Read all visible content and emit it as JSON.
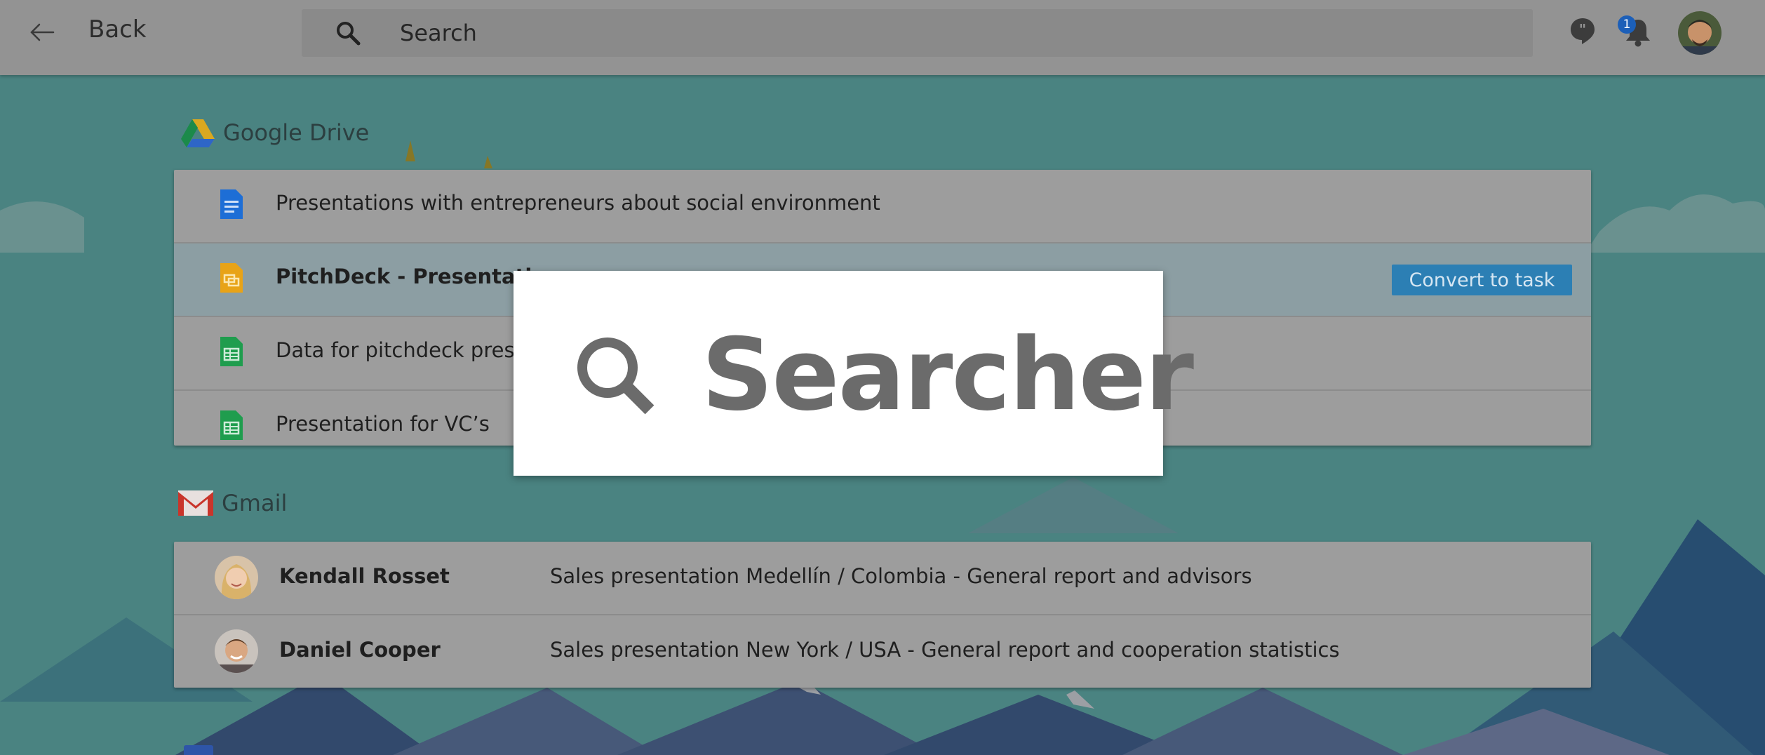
{
  "topbar": {
    "back_label": "Back",
    "search_placeholder": "Search",
    "notification_count": "1",
    "icons": [
      "arrow-left-icon",
      "search-icon",
      "chat-icon",
      "bell-icon",
      "avatar"
    ]
  },
  "drive": {
    "label": "Google Drive",
    "files": [
      {
        "title": "Presentations with entrepreneurs about social environment",
        "icon": "doc-icon",
        "color": "#1d6ed6"
      },
      {
        "title": "PitchDeck - Presentation",
        "icon": "slides-icon",
        "color": "#e8a317",
        "highlighted": true
      },
      {
        "title": "Data for pitchdeck presen",
        "icon": "sheet-icon",
        "color": "#1f9d4e"
      },
      {
        "title": "Presentation for VC’s",
        "icon": "sheet-icon",
        "color": "#1f9d4e"
      }
    ],
    "action_label": "Convert to task"
  },
  "gmail": {
    "label": "Gmail",
    "messages": [
      {
        "sender": "Kendall Rosset",
        "subject": "Sales presentation Medellín / Colombia - General report and advisors"
      },
      {
        "sender": "Daniel Cooper",
        "subject": "Sales presentation New York / USA - General report and cooperation statistics"
      }
    ]
  },
  "overlay": {
    "title": "Searcher",
    "icon": "search-icon"
  },
  "colors": {
    "topbar": "#939393",
    "card": "#9d9d9d",
    "accent_button": "#2c7fb4",
    "background_sky": "#6fc3c0"
  }
}
